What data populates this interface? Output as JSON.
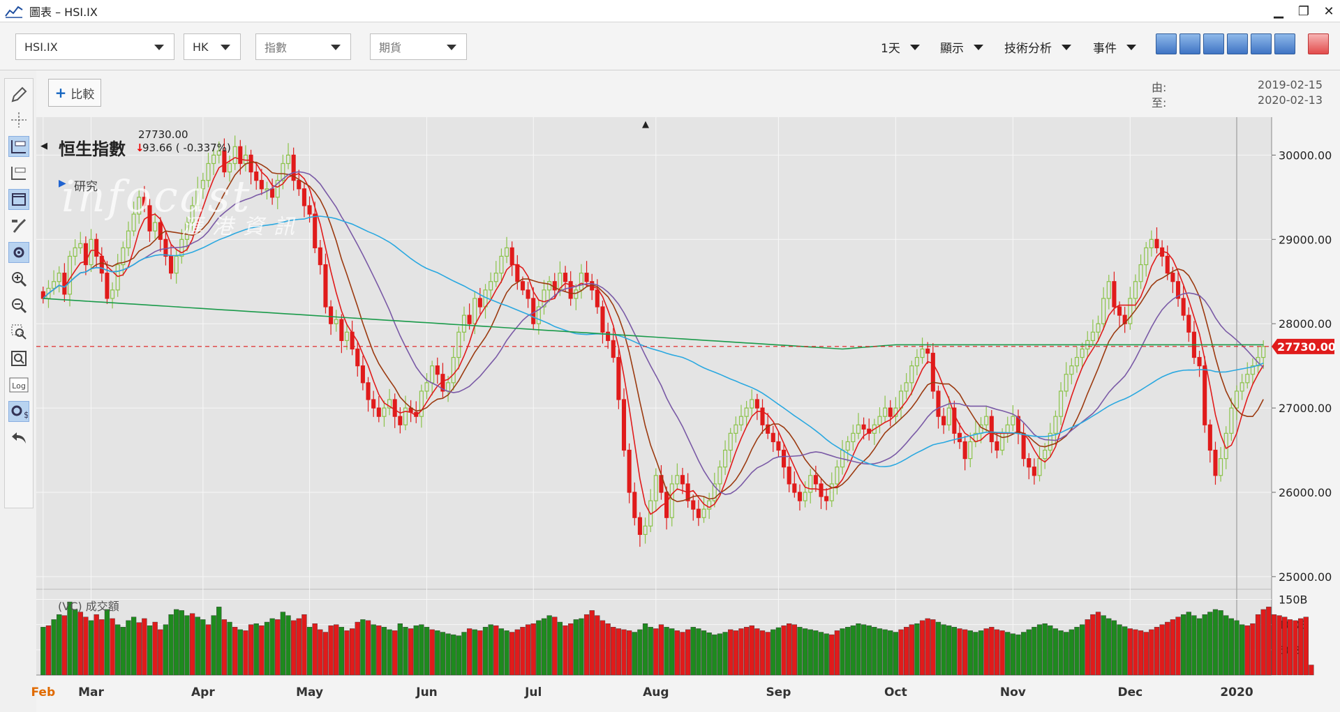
{
  "window": {
    "title": "圖表 – HSI.IX",
    "minimize": "▁",
    "restore": "❐",
    "close": "✕"
  },
  "toolbar": {
    "symbol": "HSI.IX",
    "market": "HK",
    "type_placeholder": "指數",
    "futures_placeholder": "期貨",
    "interval": "1天",
    "display": "顯示",
    "technical": "技術分析",
    "events": "事件"
  },
  "compare": {
    "label": "比較"
  },
  "range": {
    "from_label": "由:",
    "from": "2019-02-15",
    "to_label": "至:",
    "to": "2020-02-13"
  },
  "quote": {
    "name": "恒生指數",
    "price": "27730.00",
    "change": "93.66 ( -0.337%)",
    "research": "研究"
  },
  "volume_label": "(VC) 成交額",
  "watermark": {
    "brand": "infocast",
    "cn": "滙港資訊"
  },
  "colors": {
    "up": "#8bc34a",
    "down": "#e01b1b",
    "vol_up": "#1e8a1e",
    "vol_down": "#e01b1b",
    "ma5": "#e01b1b",
    "ma10": "#9b3a10",
    "ma20": "#7a5aa6",
    "ma50": "#2aa8e0",
    "ma250": "#1a9a4a",
    "price_tag": "#e01b1b"
  },
  "chart_data": {
    "type": "candlestick",
    "symbol": "HSI.IX",
    "last_price": 27730.0,
    "price_tag": "27730.00",
    "y_ticks": [
      "30000.00",
      "29000.00",
      "28000.00",
      "27000.00",
      "26000.00",
      "25000.00"
    ],
    "y_tick_values": [
      30000,
      29000,
      28000,
      27000,
      26000,
      25000
    ],
    "ylim": [
      24850,
      30450
    ],
    "vol_ticks": [
      "150B",
      "100B",
      "50B"
    ],
    "vol_tick_values": [
      150,
      100,
      50
    ],
    "vol_lim": [
      0,
      170
    ],
    "x_labels": [
      "Feb",
      "Mar",
      "Apr",
      "May",
      "Jun",
      "Jul",
      "Aug",
      "Sep",
      "Oct",
      "Nov",
      "Dec",
      "2020",
      "Feb"
    ],
    "x_label_index": [
      0,
      9,
      30,
      50,
      72,
      92,
      115,
      138,
      160,
      182,
      204,
      224,
      246
    ],
    "closes": [
      28300,
      28420,
      28500,
      28600,
      28350,
      28800,
      28900,
      28950,
      28700,
      29000,
      28800,
      28600,
      28300,
      28400,
      28700,
      28900,
      29100,
      29300,
      29500,
      29400,
      29100,
      29200,
      29000,
      28800,
      28600,
      28800,
      29000,
      29200,
      29400,
      29600,
      29700,
      29900,
      30000,
      30050,
      29800,
      29900,
      30100,
      29900,
      30000,
      29800,
      29700,
      29600,
      29600,
      29500,
      29700,
      29900,
      30000,
      29700,
      29600,
      29400,
      29300,
      28900,
      28700,
      28200,
      28000,
      28050,
      27800,
      27900,
      27700,
      27500,
      27300,
      27100,
      27000,
      26900,
      27000,
      27100,
      26900,
      26800,
      27000,
      26950,
      26900,
      27200,
      27300,
      27500,
      27400,
      27200,
      27300,
      27600,
      27900,
      28100,
      28000,
      28300,
      28200,
      28400,
      28500,
      28600,
      28800,
      28900,
      28700,
      28500,
      28400,
      28300,
      28000,
      28200,
      28400,
      28500,
      28400,
      28600,
      28500,
      28300,
      28400,
      28600,
      28500,
      28400,
      28200,
      27900,
      27800,
      27600,
      27100,
      26500,
      26000,
      25700,
      25500,
      25600,
      25900,
      26200,
      26000,
      25700,
      26100,
      26200,
      26100,
      25900,
      25800,
      25700,
      25800,
      25900,
      26100,
      26300,
      26500,
      26700,
      26800,
      26900,
      27000,
      27100,
      27000,
      26800,
      26700,
      26600,
      26500,
      26300,
      26100,
      26000,
      25900,
      26000,
      26200,
      26100,
      25950,
      25900,
      26100,
      26300,
      26500,
      26600,
      26700,
      26800,
      26750,
      26700,
      26800,
      26900,
      27000,
      26900,
      27000,
      27200,
      27300,
      27500,
      27600,
      27700,
      27650,
      27200,
      26900,
      26800,
      27000,
      26700,
      26600,
      26400,
      26600,
      26700,
      26800,
      26900,
      26600,
      26500,
      26700,
      26800,
      26900,
      26700,
      26400,
      26300,
      26200,
      26400,
      26500,
      26700,
      26900,
      27200,
      27400,
      27500,
      27600,
      27700,
      27800,
      27900,
      28000,
      28300,
      28500,
      28200,
      28100,
      28000,
      28300,
      28500,
      28700,
      28900,
      29000,
      28900,
      28800,
      28600,
      28500,
      28300,
      28100,
      27900,
      27600,
      27500,
      26800,
      26500,
      26200,
      26400,
      26700,
      27000,
      27200,
      27300,
      27400,
      27500,
      27600,
      27730
    ],
    "volumes_billion": [
      95,
      98,
      110,
      120,
      118,
      145,
      130,
      125,
      115,
      108,
      120,
      110,
      130,
      112,
      100,
      95,
      108,
      115,
      104,
      112,
      98,
      105,
      90,
      100,
      120,
      130,
      128,
      118,
      122,
      115,
      110,
      100,
      118,
      135,
      110,
      105,
      95,
      90,
      88,
      100,
      102,
      98,
      105,
      112,
      110,
      125,
      118,
      108,
      112,
      120,
      95,
      102,
      90,
      85,
      98,
      100,
      95,
      88,
      92,
      105,
      110,
      108,
      100,
      98,
      95,
      90,
      88,
      102,
      95,
      92,
      98,
      100,
      95,
      90,
      88,
      85,
      82,
      80,
      78,
      85,
      92,
      90,
      88,
      95,
      100,
      98,
      92,
      88,
      85,
      90,
      95,
      100,
      102,
      108,
      112,
      118,
      115,
      105,
      98,
      102,
      110,
      112,
      120,
      128,
      118,
      108,
      102,
      95,
      92,
      90,
      88,
      85,
      90,
      102,
      95,
      92,
      100,
      95,
      92,
      88,
      85,
      90,
      95,
      92,
      88,
      84,
      80,
      82,
      85,
      90,
      88,
      92,
      95,
      98,
      92,
      88,
      85,
      90,
      94,
      98,
      102,
      100,
      95,
      92,
      90,
      88,
      85,
      82,
      80,
      88,
      92,
      95,
      98,
      102,
      100,
      98,
      95,
      92,
      90,
      88,
      85,
      90,
      95,
      100,
      102,
      108,
      112,
      110,
      105,
      100,
      98,
      95,
      92,
      90,
      88,
      85,
      88,
      92,
      95,
      90,
      88,
      85,
      82,
      80,
      85,
      90,
      95,
      100,
      102,
      98,
      92,
      88,
      85,
      90,
      95,
      100,
      110,
      120,
      125,
      118,
      112,
      108,
      100,
      96,
      92,
      90,
      88,
      85,
      90,
      95,
      100,
      105,
      110,
      115,
      120,
      125,
      118,
      112,
      120,
      125,
      130,
      128,
      118,
      112,
      108,
      100,
      98,
      102,
      120,
      130,
      135,
      120,
      118,
      115,
      110,
      108,
      112,
      115,
      20
    ],
    "volume_up": [
      1,
      0,
      1,
      1,
      0,
      1,
      1,
      0,
      0,
      1,
      0,
      0,
      1,
      0,
      1,
      1,
      1,
      1,
      0,
      0,
      1,
      0,
      0,
      1,
      1,
      1,
      1,
      1,
      0,
      1,
      1,
      0,
      1,
      1,
      0,
      1,
      0,
      1,
      0,
      0,
      1,
      0,
      1,
      1,
      0,
      1,
      1,
      0,
      0,
      0,
      1,
      0,
      0,
      0,
      0,
      0,
      1,
      0,
      0,
      0,
      1,
      0,
      1,
      0,
      1,
      1,
      0,
      1,
      1,
      0,
      1,
      1,
      1,
      0,
      1,
      1,
      1,
      1,
      1,
      1,
      0,
      1,
      0,
      1,
      1,
      0,
      1,
      1,
      0,
      0,
      0,
      0,
      0,
      1,
      1,
      1,
      0,
      1,
      0,
      0,
      1,
      1,
      0,
      0,
      0,
      0,
      0,
      0,
      0,
      0,
      0,
      1,
      1,
      1,
      1,
      0,
      0,
      1,
      1,
      0,
      0,
      0,
      1,
      1,
      1,
      1,
      1,
      1,
      1,
      0,
      0,
      0,
      0,
      0,
      0,
      0,
      0,
      1,
      1,
      0,
      0,
      0,
      1,
      1,
      1,
      1,
      1,
      1,
      0,
      0,
      1,
      1,
      1,
      1,
      1,
      1,
      1,
      1,
      1,
      1,
      1,
      0,
      0,
      0,
      1,
      0,
      0,
      0,
      1,
      1,
      1,
      1,
      0,
      0,
      1,
      1,
      1,
      0,
      0,
      0,
      0,
      1,
      1,
      1,
      1,
      1,
      1,
      1,
      1,
      1,
      1,
      1,
      1,
      1,
      1,
      1,
      0,
      0,
      0,
      1,
      1,
      1,
      1,
      1,
      0,
      0,
      0,
      0,
      0,
      0,
      0,
      0,
      0,
      0,
      1,
      1,
      1,
      1,
      1,
      1,
      1,
      1,
      1,
      1,
      1,
      1,
      0
    ],
    "ma_series": [
      {
        "period": 5,
        "color": "#e01b1b"
      },
      {
        "period": 10,
        "color": "#9b3a10"
      },
      {
        "period": 20,
        "color": "#7a5aa6"
      },
      {
        "period": 50,
        "color": "#2aa8e0"
      },
      {
        "period": 250,
        "color": "#1a9a4a"
      }
    ]
  }
}
